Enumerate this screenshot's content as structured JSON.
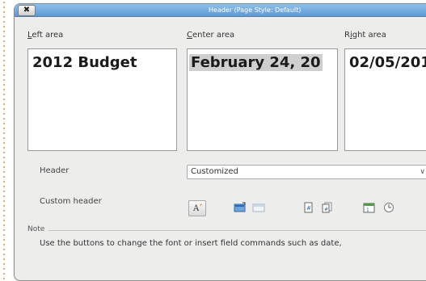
{
  "dialog": {
    "close_glyph": "✖",
    "title": "Header (Page Style: Default)"
  },
  "areas": {
    "left_label_ul": "L",
    "left_label_rest": "eft area",
    "left_value": "2012 Budget",
    "center_label_ul": "C",
    "center_label_rest": "enter area",
    "center_value": "February 24, 20",
    "right_label_pre": "R",
    "right_label_ul": "i",
    "right_label_rest": "ght area",
    "right_value": "02/05/201"
  },
  "header_row": {
    "label": "Header",
    "selected": "Customized"
  },
  "custom_header": {
    "label": "Custom header",
    "buttons": [
      "text-attributes-icon",
      "title-icon",
      "file-name-icon",
      "page-icon",
      "pages-icon",
      "date-icon",
      "time-icon"
    ]
  },
  "note": {
    "label": "Note",
    "text": "Use the buttons to change the font or insert field commands such as date,"
  }
}
